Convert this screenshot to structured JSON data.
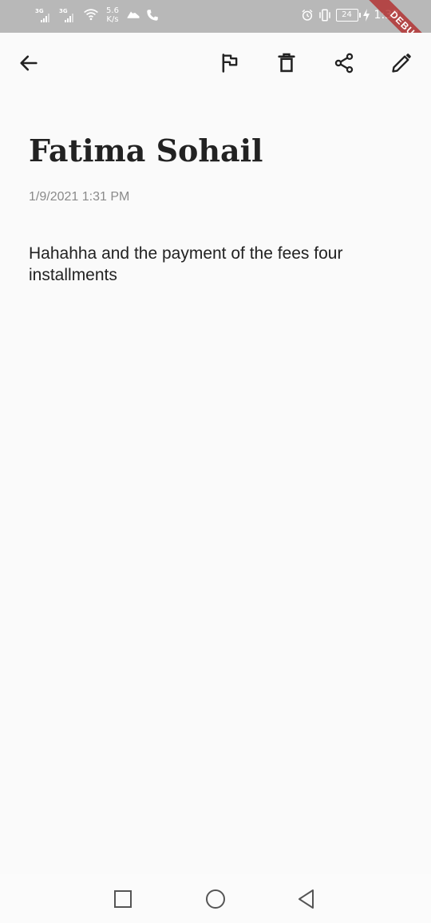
{
  "status_bar": {
    "network_type_1": "3G",
    "network_type_2": "3G",
    "speed_value": "5.6",
    "speed_unit": "K/s",
    "battery_level": "24",
    "time": "1:33",
    "icons": [
      "signal-icon",
      "signal-icon",
      "wifi-icon",
      "sneaker-icon",
      "phone-icon",
      "alarm-icon",
      "vibrate-icon",
      "battery-icon",
      "charging-icon"
    ]
  },
  "debug_banner": "DEBUG",
  "toolbar": {
    "back_icon": "arrow-left-icon",
    "actions": [
      "flag-icon",
      "delete-icon",
      "share-icon",
      "edit-icon"
    ]
  },
  "note": {
    "title": "Fatima Sohail",
    "date": "1/9/2021 1:31 PM",
    "body": "Hahahha and the payment of the fees four installments"
  },
  "nav_bar": {
    "buttons": [
      "recents-square-icon",
      "home-circle-icon",
      "back-triangle-icon"
    ]
  },
  "colors": {
    "background": "#fafafa",
    "status_bar": "#b8b8b8",
    "title": "#222222",
    "date": "#8a8a8a",
    "debug_ribbon": "#b22222"
  }
}
